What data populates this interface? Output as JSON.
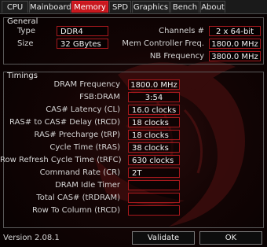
{
  "tabs": [
    "CPU",
    "Mainboard",
    "Memory",
    "SPD",
    "Graphics",
    "Bench",
    "About"
  ],
  "active_tab": "Memory",
  "general": {
    "title": "General",
    "type_label": "Type",
    "type_value": "DDR4",
    "size_label": "Size",
    "size_value": "32 GBytes",
    "channels_label": "Channels #",
    "channels_value": "2 x 64-bit",
    "mem_ctrl_label": "Mem Controller Freq.",
    "mem_ctrl_value": "1800.0 MHz",
    "nb_freq_label": "NB Frequency",
    "nb_freq_value": "3800.0 MHz"
  },
  "timings": {
    "title": "Timings",
    "rows": [
      {
        "label": "DRAM Frequency",
        "value": "1800.0 MHz"
      },
      {
        "label": "FSB:DRAM",
        "value": "3:54"
      },
      {
        "label": "CAS# Latency (CL)",
        "value": "16.0 clocks"
      },
      {
        "label": "RAS# to CAS# Delay (tRCD)",
        "value": "18 clocks"
      },
      {
        "label": "RAS# Precharge (tRP)",
        "value": "18 clocks"
      },
      {
        "label": "Cycle Time (tRAS)",
        "value": "38 clocks"
      },
      {
        "label": "Row Refresh Cycle Time (tRFC)",
        "value": "630 clocks"
      },
      {
        "label": "Command Rate (CR)",
        "value": "2T"
      },
      {
        "label": "DRAM Idle Timer",
        "value": ""
      },
      {
        "label": "Total CAS# (tRDRAM)",
        "value": ""
      },
      {
        "label": "Row To Column (tRCD)",
        "value": ""
      }
    ]
  },
  "footer": {
    "version": "Version 2.08.1",
    "validate_label": "Validate",
    "ok_label": "OK"
  },
  "colors": {
    "accent": "#c9181e",
    "field_border": "#a8191d"
  },
  "icons": [
    "dragon-watermark-icon"
  ]
}
